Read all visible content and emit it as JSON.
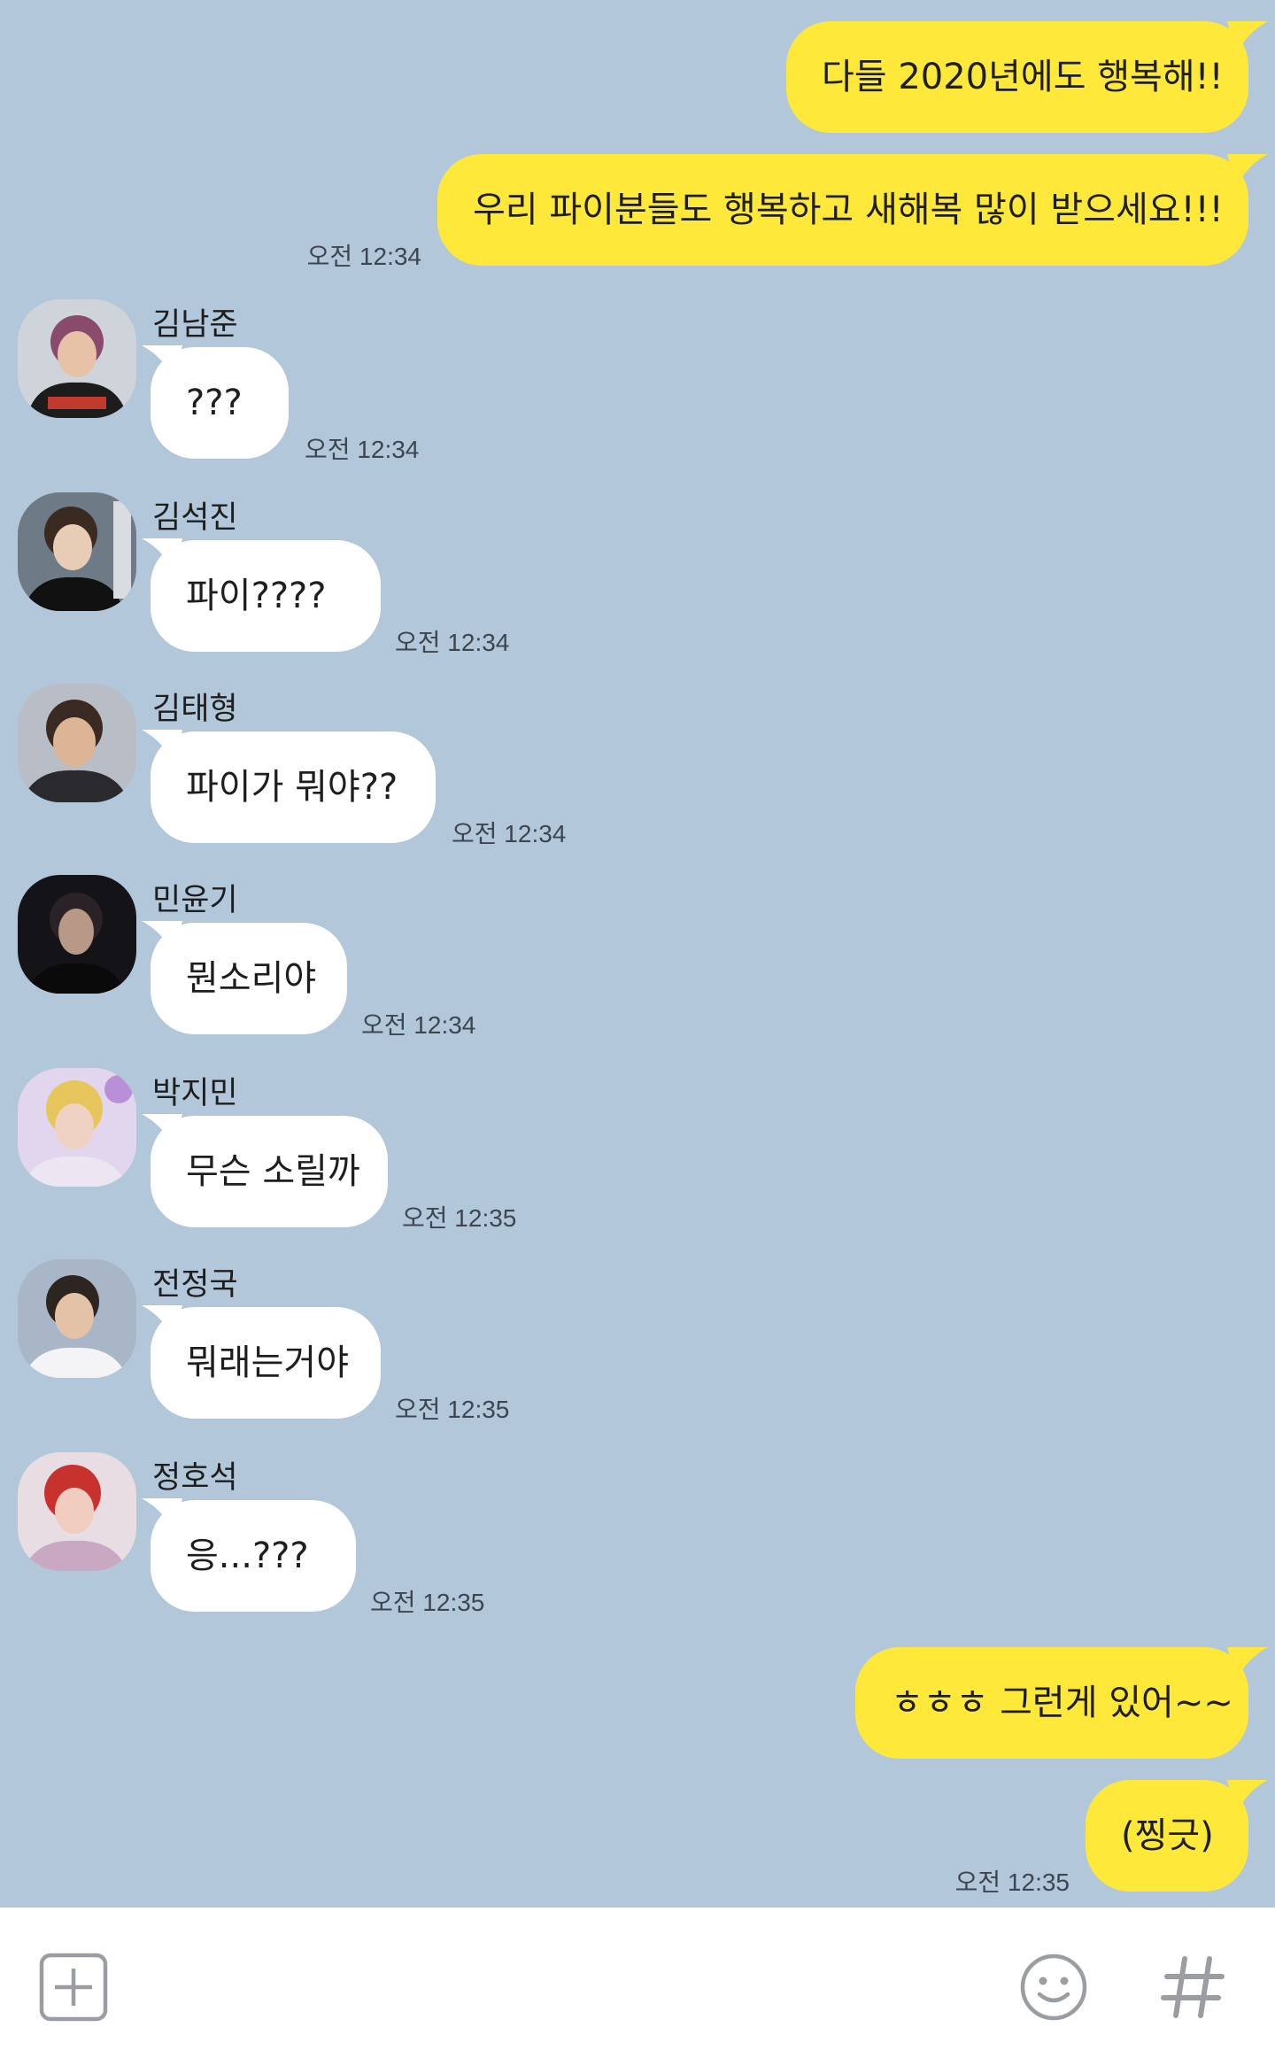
{
  "messages": [
    {
      "from": "me",
      "text": "다들 2020년에도 행복해!!"
    },
    {
      "from": "me",
      "text": "우리 파이분들도 행복하고 새해복 많이 받으세요!!!",
      "time": "오전 12:34"
    },
    {
      "from": "other",
      "name": "김남준",
      "text": "???",
      "time": "오전 12:34",
      "avatar": "avatar-namjoon"
    },
    {
      "from": "other",
      "name": "김석진",
      "text": "파이????",
      "time": "오전 12:34",
      "avatar": "avatar-seokjin"
    },
    {
      "from": "other",
      "name": "김태형",
      "text": "파이가 뭐야??",
      "time": "오전 12:34",
      "avatar": "avatar-taehyung"
    },
    {
      "from": "other",
      "name": "민윤기",
      "text": "뭔소리야",
      "time": "오전 12:34",
      "avatar": "avatar-yoongi"
    },
    {
      "from": "other",
      "name": "박지민",
      "text": "무슨 소릴까",
      "time": "오전 12:35",
      "avatar": "avatar-jimin"
    },
    {
      "from": "other",
      "name": "전정국",
      "text": "뭐래는거야",
      "time": "오전 12:35",
      "avatar": "avatar-jungkook"
    },
    {
      "from": "other",
      "name": "정호석",
      "text": "응...???",
      "time": "오전 12:35",
      "avatar": "avatar-hoseok"
    },
    {
      "from": "me",
      "text": "ㅎㅎㅎ 그런게 있어~~"
    },
    {
      "from": "me",
      "text": "(찡긋)",
      "time": "오전 12:35"
    }
  ],
  "input_bar": {
    "icons": [
      "plus-square-icon",
      "emoji-icon",
      "hashtag-icon"
    ]
  },
  "colors": {
    "background": "#b2c7da",
    "my_bubble": "#fee93a",
    "other_bubble": "#ffffff"
  }
}
